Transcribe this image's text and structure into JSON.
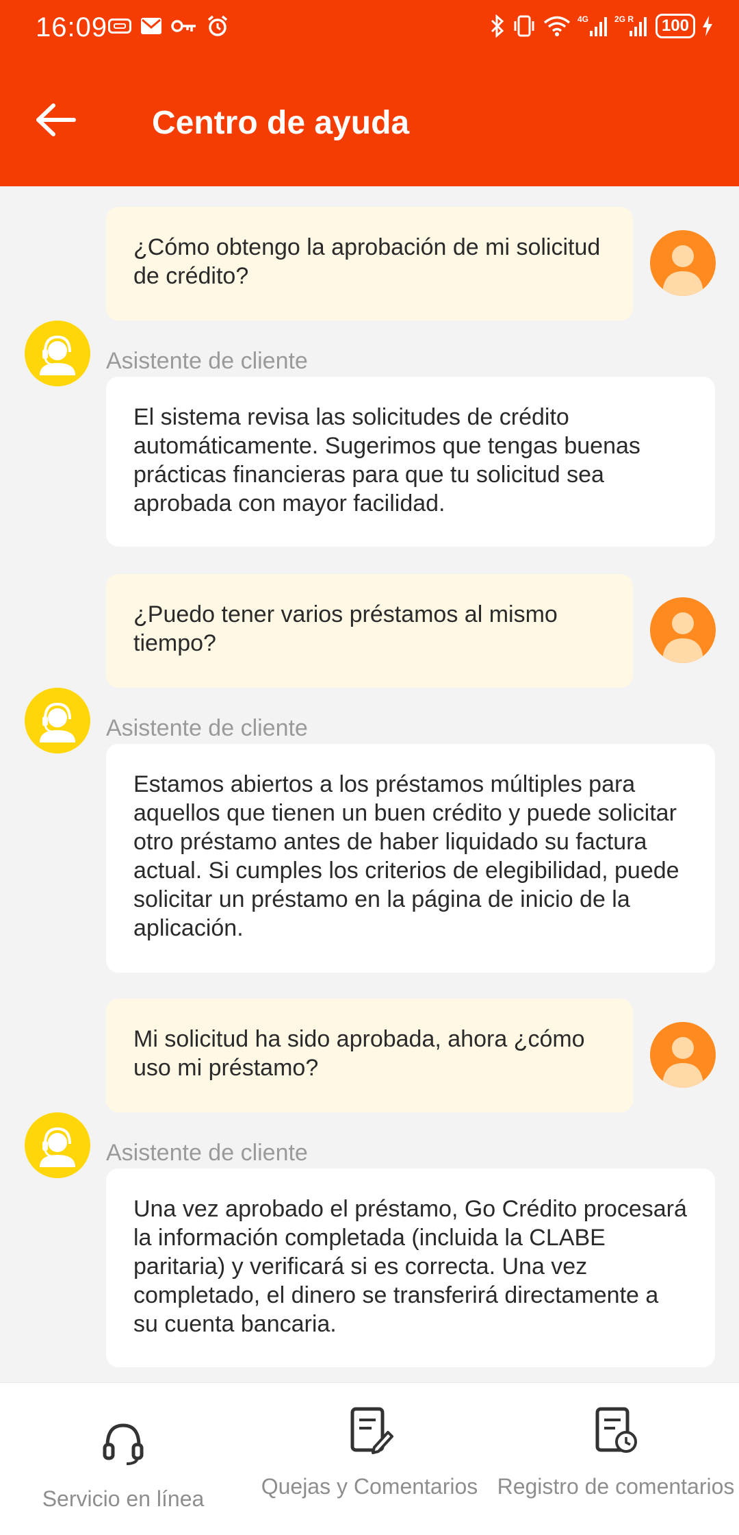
{
  "status_bar": {
    "time": "16:09",
    "battery": "100",
    "icons_left": [
      "sim-icon",
      "mail-icon",
      "key-icon",
      "alarm-icon"
    ],
    "icons_right": [
      "bluetooth-icon",
      "vibrate-icon",
      "wifi-icon",
      "signal-4g-icon",
      "signal-2g-icon",
      "battery-icon",
      "charging-icon"
    ],
    "signal_labels": [
      "4G",
      "2G R"
    ]
  },
  "header": {
    "title": "Centro de ayuda",
    "background": "#f53c02"
  },
  "agent_name": "Asistente de cliente",
  "messages": [
    {
      "question": "¿Cómo obtengo la aprobación de mi solicitud de crédito?",
      "answer": "El sistema revisa las solicitudes de crédito automáticamente. Sugerimos que tengas buenas prácticas financieras para que tu solicitud sea aprobada con mayor facilidad."
    },
    {
      "question": "¿Puedo tener varios préstamos al mismo tiempo?",
      "answer": "Estamos abiertos a los préstamos múltiples para aquellos que tienen un buen crédito y puede solicitar otro préstamo antes de haber liquidado su factura actual. Si cumples los criterios de elegibilidad, puede solicitar un préstamo en la página de inicio de la aplicación."
    },
    {
      "question": "Mi solicitud ha sido aprobada, ahora ¿cómo uso mi préstamo?",
      "answer": "Una vez aprobado el préstamo, Go Crédito procesará la información completada (incluida la CLABE paritaria) y verificará si es correcta. Una vez completado, el dinero se transferirá directamente a su cuenta bancaria."
    }
  ],
  "bottom_nav": [
    {
      "label": "Servicio en línea",
      "icon": "headset-icon"
    },
    {
      "label": "Quejas y Comentarios",
      "icon": "feedback-edit-icon"
    },
    {
      "label": "Registro de comentarios",
      "icon": "feedback-history-icon"
    }
  ],
  "colors": {
    "accent": "#f53c02",
    "question_bubble": "#fff8e5",
    "answer_bubble": "#ffffff",
    "user_avatar": "#ff8a1f",
    "agent_avatar": "#ffd60a"
  }
}
